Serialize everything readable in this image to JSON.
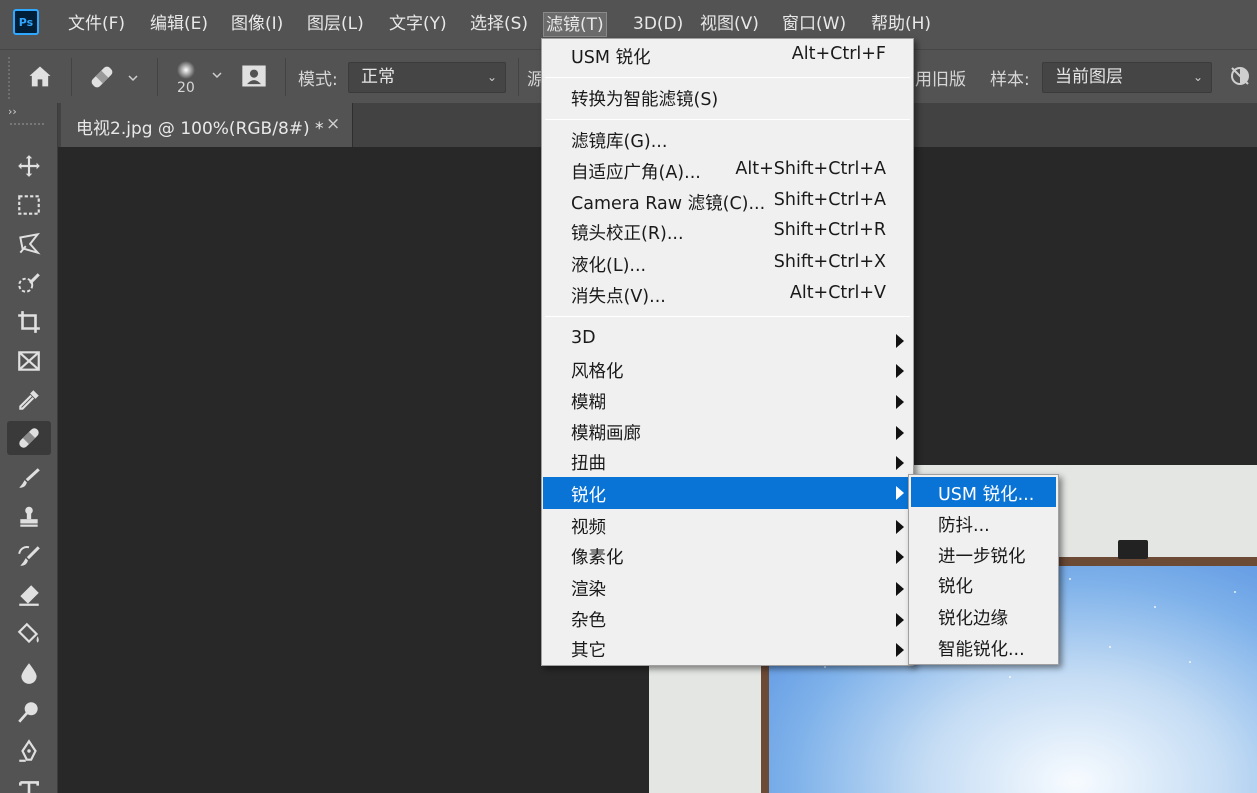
{
  "app": {
    "logo": "Ps"
  },
  "menubar": {
    "items": [
      "文件(F)",
      "编辑(E)",
      "图像(I)",
      "图层(L)",
      "文字(Y)",
      "选择(S)",
      "滤镜(T)",
      "3D(D)",
      "视图(V)",
      "窗口(W)",
      "帮助(H)"
    ],
    "active": "滤镜(T)"
  },
  "options": {
    "brush_size": "20",
    "mode_label": "模式:",
    "mode_value": "正常",
    "source_label_partial": "源",
    "legacy_partial": "用旧版",
    "sample_label": "样本:",
    "sample_value": "当前图层"
  },
  "document": {
    "tab_title": "电视2.jpg @ 100%(RGB/8#) *",
    "close_glyph": "×"
  },
  "filter_menu": {
    "last_filter": {
      "label": "USM 锐化",
      "shortcut": "Alt+Ctrl+F"
    },
    "convert_smart": {
      "label": "转换为智能滤镜(S)"
    },
    "group2": [
      {
        "label": "滤镜库(G)...",
        "shortcut": ""
      },
      {
        "label": "自适应广角(A)...",
        "shortcut": "Alt+Shift+Ctrl+A"
      },
      {
        "label": "Camera Raw 滤镜(C)...",
        "shortcut": "Shift+Ctrl+A"
      },
      {
        "label": "镜头校正(R)...",
        "shortcut": "Shift+Ctrl+R"
      },
      {
        "label": "液化(L)...",
        "shortcut": "Shift+Ctrl+X"
      },
      {
        "label": "消失点(V)...",
        "shortcut": "Alt+Ctrl+V"
      }
    ],
    "submenus": [
      "3D",
      "风格化",
      "模糊",
      "模糊画廊",
      "扭曲",
      "锐化",
      "视频",
      "像素化",
      "渲染",
      "杂色",
      "其它"
    ],
    "highlighted": "锐化"
  },
  "sharpen_submenu": {
    "items": [
      "USM 锐化...",
      "防抖...",
      "进一步锐化",
      "锐化",
      "锐化边缘",
      "智能锐化..."
    ],
    "highlighted": "USM 锐化..."
  },
  "tools": [
    "move-icon",
    "marquee-icon",
    "lasso-icon",
    "quick-select-icon",
    "crop-icon",
    "frame-icon",
    "eyedropper-icon",
    "healing-brush-icon",
    "brush-icon",
    "clone-stamp-icon",
    "history-brush-icon",
    "eraser-icon",
    "paint-bucket-icon",
    "blur-icon",
    "dodge-icon",
    "pen-icon",
    "type-icon"
  ],
  "colors": {
    "menu_highlight": "#0a74d6",
    "ui_panel": "#535353",
    "canvas_bg": "#282828",
    "menu_bg": "#f0f0f0"
  }
}
